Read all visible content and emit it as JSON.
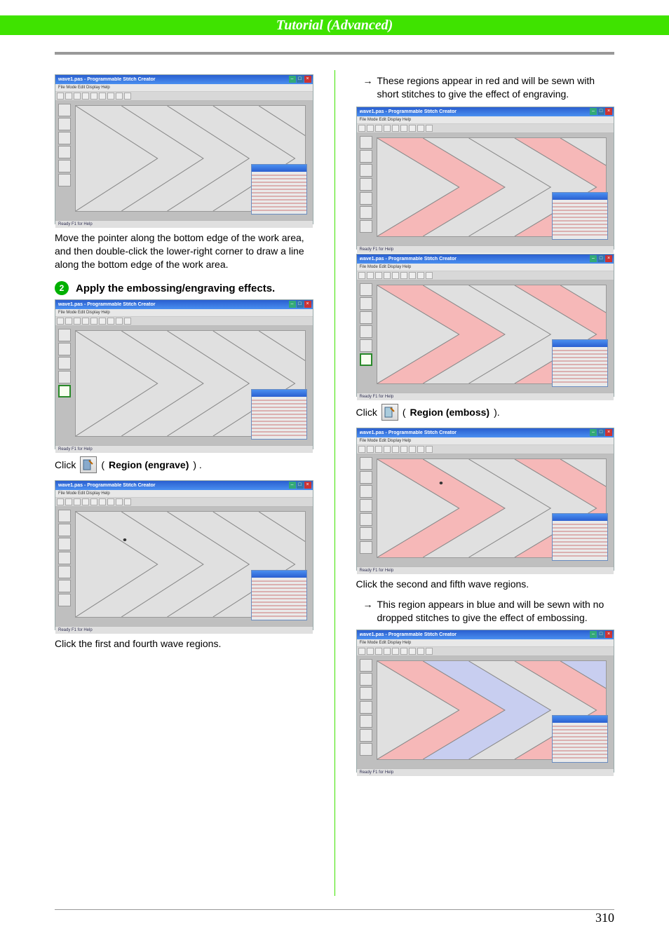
{
  "header": {
    "title": "Tutorial (Advanced)"
  },
  "app": {
    "window_title": "wave1.pas - Programmable Stitch Creator",
    "menu": "File  Mode  Edit  Display  Help",
    "status": "Ready F1 for Help"
  },
  "left": {
    "p1": "Move the pointer along the bottom edge of the work area, and then double-click the lower-right corner to draw a line along the bottom edge of the work area.",
    "step2_num": "2",
    "step2_title": "Apply the embossing/engraving effects.",
    "click_prefix": "Click",
    "engrave_label": "Region (engrave)",
    "engrave_tail": ") .",
    "p2": "Click the first and fourth wave regions."
  },
  "right": {
    "arrow1": "These regions appear in red and will be sewn with short stitches to give the effect of engraving.",
    "click_prefix": "Click",
    "emboss_label": "Region (emboss)",
    "emboss_tail": ").",
    "p1": "Click the second and fifth wave regions.",
    "arrow2": "This region appears in blue and will be sewn with no dropped stitches to give the effect of embossing."
  },
  "page_number": "310"
}
